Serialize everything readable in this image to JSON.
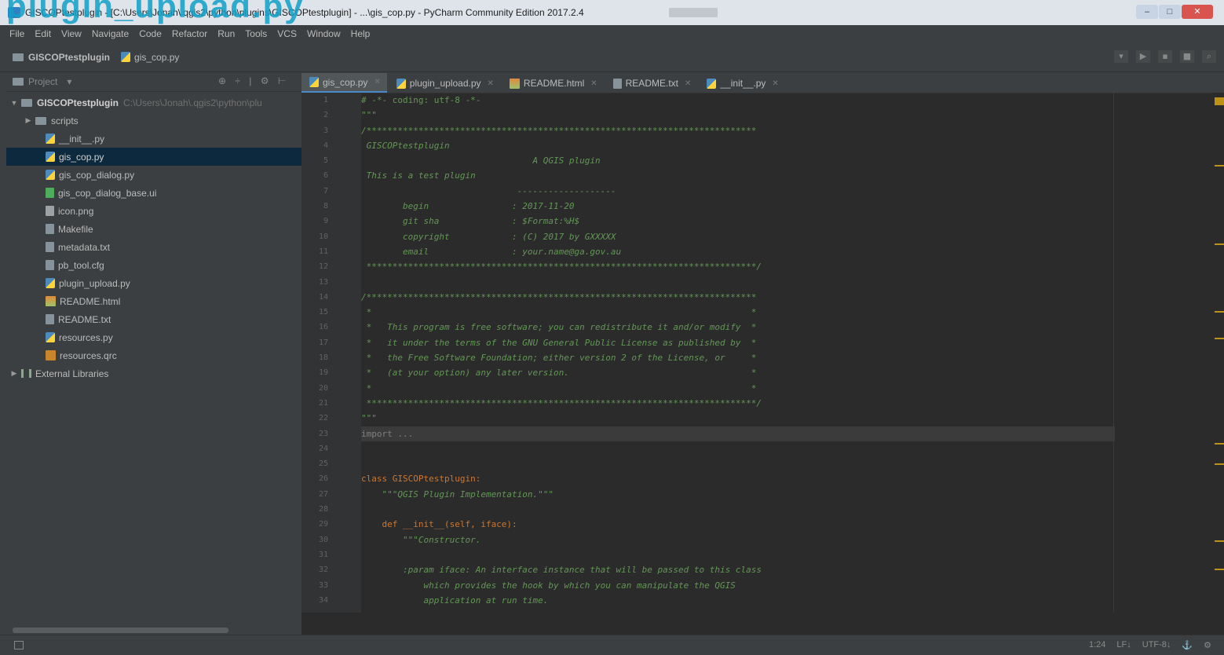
{
  "window": {
    "title": "GISCOPtestplugin - [C:\\Users\\Jonah\\.qgis2\\python\\plugins\\GISCOPtestplugin] - ...\\gis_cop.py - PyCharm Community Edition 2017.2.4",
    "overlay_title": "plugin_upload.py",
    "buttons": {
      "minimize": "–",
      "maximize": "□",
      "close": "✕"
    }
  },
  "menu": [
    "File",
    "Edit",
    "View",
    "Navigate",
    "Code",
    "Refactor",
    "Run",
    "Tools",
    "VCS",
    "Window",
    "Help"
  ],
  "breadcrumb": {
    "project": "GISCOPtestplugin",
    "file": "gis_cop.py"
  },
  "project_panel": {
    "label": "Project",
    "tools": "⊕ ÷ | ⚙ ⊢",
    "root": {
      "name": "GISCOPtestplugin",
      "path": "C:\\Users\\Jonah\\.qgis2\\python\\plu"
    },
    "items": [
      {
        "name": "scripts",
        "type": "folder"
      },
      {
        "name": "__init__.py",
        "type": "py"
      },
      {
        "name": "gis_cop.py",
        "type": "py",
        "selected": true
      },
      {
        "name": "gis_cop_dialog.py",
        "type": "py"
      },
      {
        "name": "gis_cop_dialog_base.ui",
        "type": "ui"
      },
      {
        "name": "icon.png",
        "type": "img"
      },
      {
        "name": "Makefile",
        "type": "file"
      },
      {
        "name": "metadata.txt",
        "type": "file"
      },
      {
        "name": "pb_tool.cfg",
        "type": "file"
      },
      {
        "name": "plugin_upload.py",
        "type": "py"
      },
      {
        "name": "README.html",
        "type": "html"
      },
      {
        "name": "README.txt",
        "type": "file"
      },
      {
        "name": "resources.py",
        "type": "py"
      },
      {
        "name": "resources.qrc",
        "type": "qrc"
      }
    ],
    "external": "External Libraries"
  },
  "tabs": [
    {
      "label": "gis_cop.py",
      "active": true
    },
    {
      "label": "plugin_upload.py"
    },
    {
      "label": "README.html"
    },
    {
      "label": "README.txt"
    },
    {
      "label": "__init__.py"
    }
  ],
  "line_numbers": [
    "1",
    "2",
    "3",
    "4",
    "5",
    "6",
    "7",
    "8",
    "9",
    "10",
    "11",
    "12",
    "13",
    "14",
    "15",
    "16",
    "17",
    "18",
    "19",
    "20",
    "21",
    "22",
    "23",
    "24",
    "25",
    "26",
    "27",
    "28",
    "29",
    "30",
    "31",
    "32",
    "33",
    "34"
  ],
  "code_lines": [
    "# -*- coding: utf-8 -*-",
    "\"\"\"",
    "/***************************************************************************",
    " GISCOPtestplugin",
    "                                 A QGIS plugin",
    " This is a test plugin",
    "                              -------------------",
    "        begin                : 2017-11-20",
    "        git sha              : $Format:%H$",
    "        copyright            : (C) 2017 by GXXXXX",
    "        email                : your.name@ga.gov.au",
    " ***************************************************************************/",
    "",
    "/***************************************************************************",
    " *                                                                         *",
    " *   This program is free software; you can redistribute it and/or modify  *",
    " *   it under the terms of the GNU General Public License as published by  *",
    " *   the Free Software Foundation; either version 2 of the License, or     *",
    " *   (at your option) any later version.                                   *",
    " *                                                                         *",
    " ***************************************************************************/",
    "\"\"\"",
    "import ...",
    "",
    "",
    "class GISCOPtestplugin:",
    "    \"\"\"QGIS Plugin Implementation.\"\"\"",
    "",
    "    def __init__(self, iface):",
    "        \"\"\"Constructor.",
    "",
    "        :param iface: An interface instance that will be passed to this class",
    "            which provides the hook by which you can manipulate the QGIS",
    "            application at run time."
  ],
  "status": {
    "position": "1:24",
    "line_sep": "LF↓",
    "encoding": "UTF-8↓",
    "lock": "⚓",
    "git": "⚙"
  }
}
